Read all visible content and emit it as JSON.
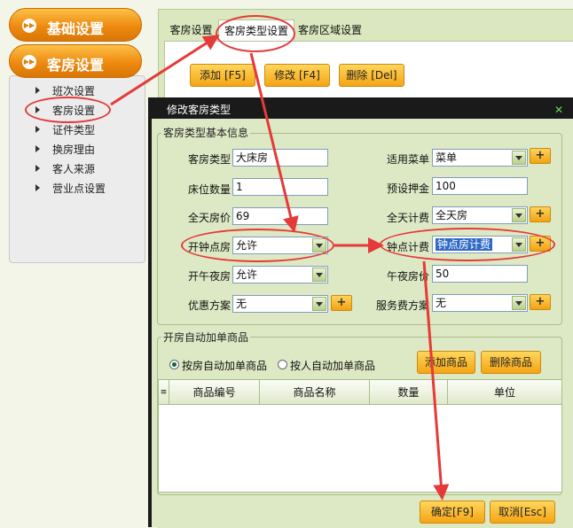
{
  "nav": {
    "basic_settings": "基础设置",
    "room_settings": "客房设置",
    "items": [
      "班次设置",
      "客房设置",
      "证件类型",
      "换房理由",
      "客人来源",
      "营业点设置"
    ]
  },
  "tabs": [
    "客房设置",
    "客房类型设置",
    "客房区域设置"
  ],
  "toolbar": {
    "add": "添加 [F5]",
    "edit": "修改 [F4]",
    "delete": "删除 [Del]"
  },
  "dialog": {
    "title": "修改客房类型",
    "close_glyph": "✕",
    "basic_group": "客房类型基本信息",
    "fields": {
      "room_type": {
        "label": "客房类型",
        "value": "大床房"
      },
      "bed_count": {
        "label": "床位数量",
        "value": "1"
      },
      "day_price": {
        "label": "全天房价",
        "value": "69"
      },
      "hourly_room": {
        "label": "开钟点房",
        "value": "允许"
      },
      "midnight_room": {
        "label": "开午夜房",
        "value": "允许"
      },
      "discount": {
        "label": "优惠方案",
        "value": "无"
      },
      "menu": {
        "label": "适用菜单",
        "value": "菜单"
      },
      "deposit": {
        "label": "预设押金",
        "value": "100"
      },
      "day_billing": {
        "label": "全天计费",
        "value": "全天房"
      },
      "hourly_billing": {
        "label": "钟点计费",
        "value": "钟点房计费"
      },
      "midnight_price": {
        "label": "午夜房价",
        "value": "50"
      },
      "service_fee": {
        "label": "服务费方案",
        "value": "无"
      }
    },
    "plus": "+",
    "goods_group": "开房自动加单商品",
    "radio_by_room": "按房自动加单商品",
    "radio_by_person": "按人自动加单商品",
    "add_goods": "添加商品",
    "delete_goods": "删除商品",
    "grid_columns": [
      "商品编号",
      "商品名称",
      "数量",
      "单位"
    ],
    "grid_handle": "≡",
    "ok": "确定[F9]",
    "cancel": "取消[Esc]"
  },
  "colors": {
    "accent_orange": "#f2a213",
    "annotation_red": "#e53a3a",
    "panel_green": "#dde9c4"
  }
}
